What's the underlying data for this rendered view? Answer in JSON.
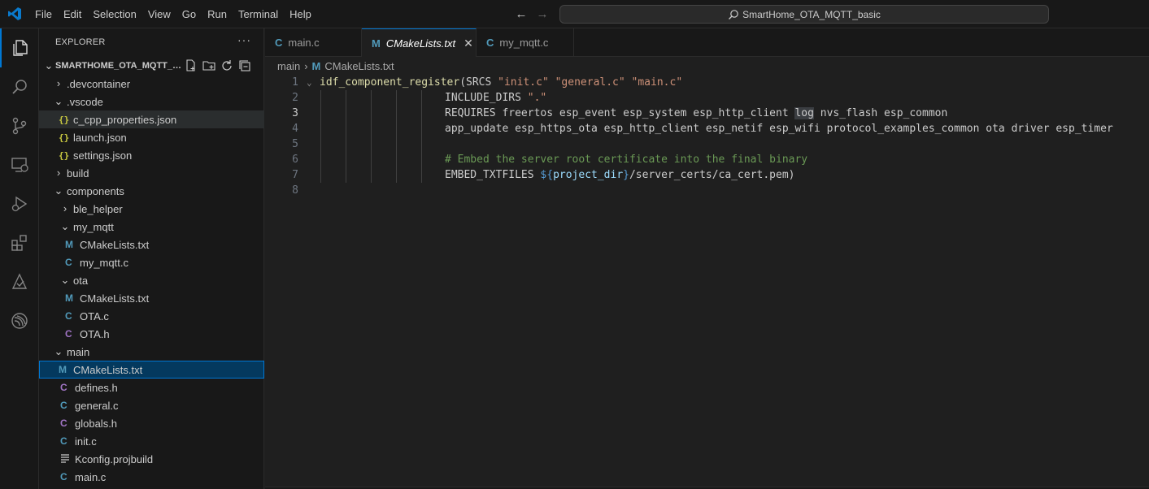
{
  "titlebar": {
    "menu": [
      "File",
      "Edit",
      "Selection",
      "View",
      "Go",
      "Run",
      "Terminal",
      "Help"
    ],
    "search_text": "SmartHome_OTA_MQTT_basic"
  },
  "activitybar": {
    "items": [
      "explorer-icon",
      "search-icon",
      "source-control-icon",
      "remote-explorer-icon",
      "run-debug-icon",
      "extensions-icon",
      "idf-icon",
      "espressif-icon"
    ]
  },
  "sidebar": {
    "title": "EXPLORER",
    "more": "···",
    "root": "SMARTHOME_OTA_MQTT_BASIC",
    "tree": [
      {
        "label": ".devcontainer",
        "type": "folder",
        "expanded": false,
        "depth": 1
      },
      {
        "label": ".vscode",
        "type": "folder",
        "expanded": true,
        "depth": 1
      },
      {
        "label": "c_cpp_properties.json",
        "type": "json",
        "depth": 2
      },
      {
        "label": "launch.json",
        "type": "json",
        "depth": 2
      },
      {
        "label": "settings.json",
        "type": "json",
        "depth": 2
      },
      {
        "label": "build",
        "type": "folder",
        "expanded": false,
        "depth": 1
      },
      {
        "label": "components",
        "type": "folder",
        "expanded": true,
        "depth": 1
      },
      {
        "label": "ble_helper",
        "type": "folder",
        "expanded": false,
        "depth": 2
      },
      {
        "label": "my_mqtt",
        "type": "folder",
        "expanded": true,
        "depth": 2
      },
      {
        "label": "CMakeLists.txt",
        "type": "cmake",
        "depth": 3
      },
      {
        "label": "my_mqtt.c",
        "type": "c",
        "depth": 3
      },
      {
        "label": "ota",
        "type": "folder",
        "expanded": true,
        "depth": 2
      },
      {
        "label": "CMakeLists.txt",
        "type": "cmake",
        "depth": 3
      },
      {
        "label": "OTA.c",
        "type": "c",
        "depth": 3
      },
      {
        "label": "OTA.h",
        "type": "h",
        "depth": 3
      },
      {
        "label": "main",
        "type": "folder",
        "expanded": true,
        "depth": 1
      },
      {
        "label": "CMakeLists.txt",
        "type": "cmake",
        "depth": 2
      },
      {
        "label": "defines.h",
        "type": "h",
        "depth": 2
      },
      {
        "label": "general.c",
        "type": "c",
        "depth": 2
      },
      {
        "label": "globals.h",
        "type": "h",
        "depth": 2
      },
      {
        "label": "init.c",
        "type": "c",
        "depth": 2
      },
      {
        "label": "Kconfig.projbuild",
        "type": "text",
        "depth": 2
      },
      {
        "label": "main.c",
        "type": "c",
        "depth": 2
      }
    ]
  },
  "tabs": [
    {
      "label": "main.c",
      "icon": "C",
      "active": false
    },
    {
      "label": "CMakeLists.txt",
      "icon": "M",
      "active": true
    },
    {
      "label": "my_mqtt.c",
      "icon": "C",
      "active": false
    }
  ],
  "breadcrumb": {
    "folder": "main",
    "file": "CMakeLists.txt"
  },
  "editor": {
    "line_numbers": [
      "1",
      "2",
      "3",
      "4",
      "5",
      "6",
      "7",
      "8"
    ],
    "current_line": 3,
    "code": {
      "l1_fn": "idf_component_register",
      "l1_a": "(SRCS ",
      "l1_s1": "\"init.c\"",
      "l1_s2": "\"general.c\"",
      "l1_s3": "\"main.c\"",
      "l2_kw": "INCLUDE_DIRS ",
      "l2_s": "\".\"",
      "l3_a": "REQUIRES freertos esp_event esp_system esp_http_client ",
      "l3_hl": "log",
      "l3_b": " nvs_flash esp_common",
      "l4": "app_update esp_https_ota esp_http_client esp_netif esp_wifi protocol_examples_common ota driver esp_timer",
      "l6": "# Embed the server root certificate into the final binary",
      "l7_a": "EMBED_TXTFILES ",
      "l7_var_open": "${",
      "l7_var": "project_dir",
      "l7_var_close": "}",
      "l7_b": "/server_certs/ca_cert.pem)"
    }
  },
  "colors": {
    "accent": "#0078d4",
    "string": "#ce9178",
    "function": "#dcdcaa",
    "comment": "#6a9955"
  }
}
